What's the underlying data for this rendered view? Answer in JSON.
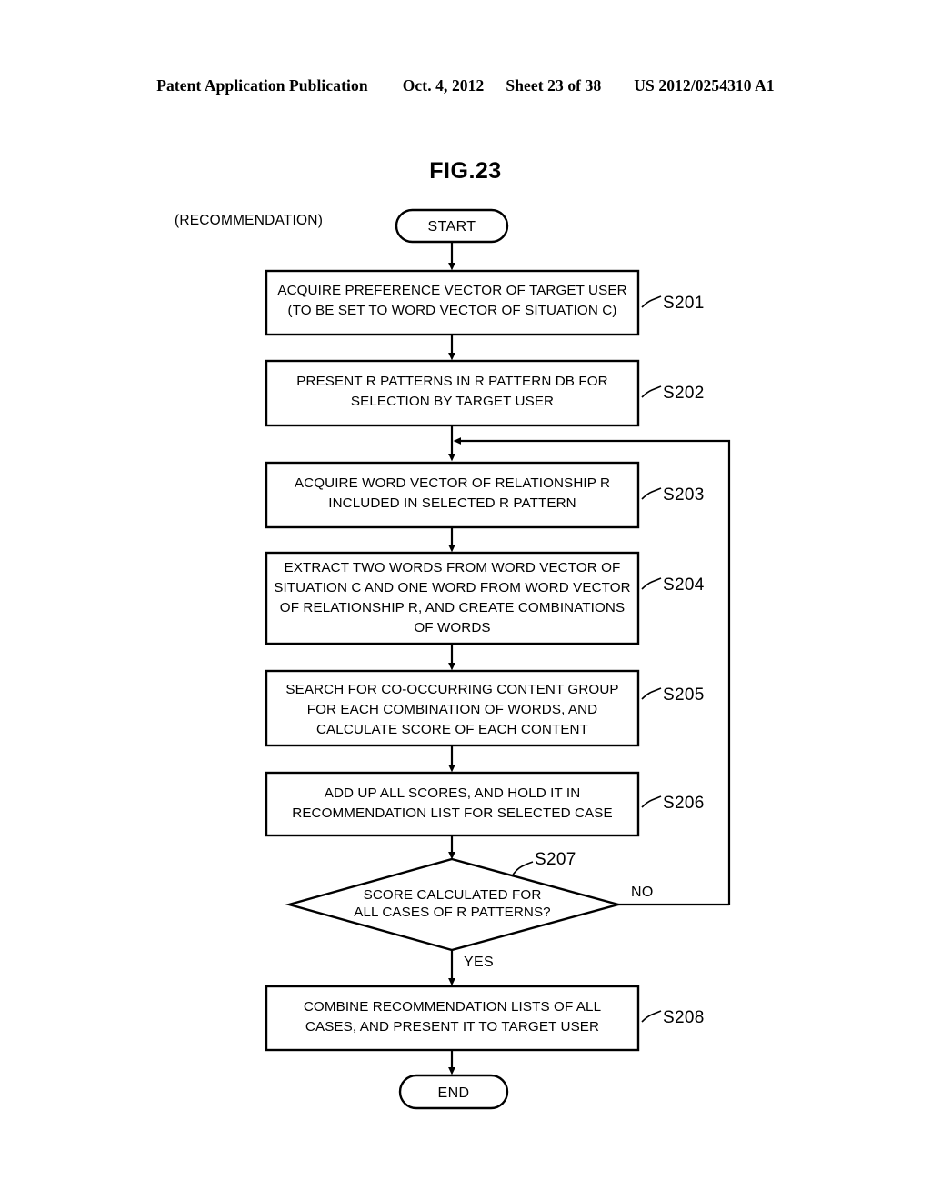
{
  "header": {
    "publication": "Patent Application Publication",
    "date": "Oct. 4, 2012",
    "sheet": "Sheet 23 of 38",
    "docnum": "US 2012/0254310 A1"
  },
  "figure": {
    "title": "FIG.23",
    "mode_caption": "(RECOMMENDATION)"
  },
  "terminators": {
    "start": "START",
    "end": "END"
  },
  "branches": {
    "no": "NO",
    "yes": "YES"
  },
  "nodes": [
    {
      "id": "S201",
      "step": "S201",
      "lines": [
        "ACQUIRE PREFERENCE VECTOR OF TARGET USER",
        "(TO BE SET TO WORD VECTOR OF SITUATION C)"
      ]
    },
    {
      "id": "S202",
      "step": "S202",
      "lines": [
        "PRESENT R PATTERNS IN R PATTERN DB FOR",
        "SELECTION BY TARGET USER"
      ]
    },
    {
      "id": "S203",
      "step": "S203",
      "lines": [
        "ACQUIRE WORD VECTOR OF RELATIONSHIP R",
        "INCLUDED IN SELECTED R PATTERN"
      ]
    },
    {
      "id": "S204",
      "step": "S204",
      "lines": [
        "EXTRACT TWO WORDS FROM WORD VECTOR OF",
        "SITUATION C AND ONE WORD FROM WORD VECTOR",
        "OF RELATIONSHIP R, AND CREATE COMBINATIONS",
        "OF WORDS"
      ]
    },
    {
      "id": "S205",
      "step": "S205",
      "lines": [
        "SEARCH FOR CO-OCCURRING CONTENT GROUP",
        "FOR EACH COMBINATION OF WORDS, AND",
        "CALCULATE SCORE OF EACH CONTENT"
      ]
    },
    {
      "id": "S206",
      "step": "S206",
      "lines": [
        "ADD UP ALL SCORES, AND HOLD IT IN",
        "RECOMMENDATION LIST FOR SELECTED CASE"
      ]
    },
    {
      "id": "S207",
      "step": "S207",
      "lines": [
        "SCORE CALCULATED FOR",
        "ALL CASES OF R PATTERNS?"
      ]
    },
    {
      "id": "S208",
      "step": "S208",
      "lines": [
        "COMBINE RECOMMENDATION LISTS OF ALL",
        "CASES, AND PRESENT IT TO TARGET USER"
      ]
    }
  ]
}
